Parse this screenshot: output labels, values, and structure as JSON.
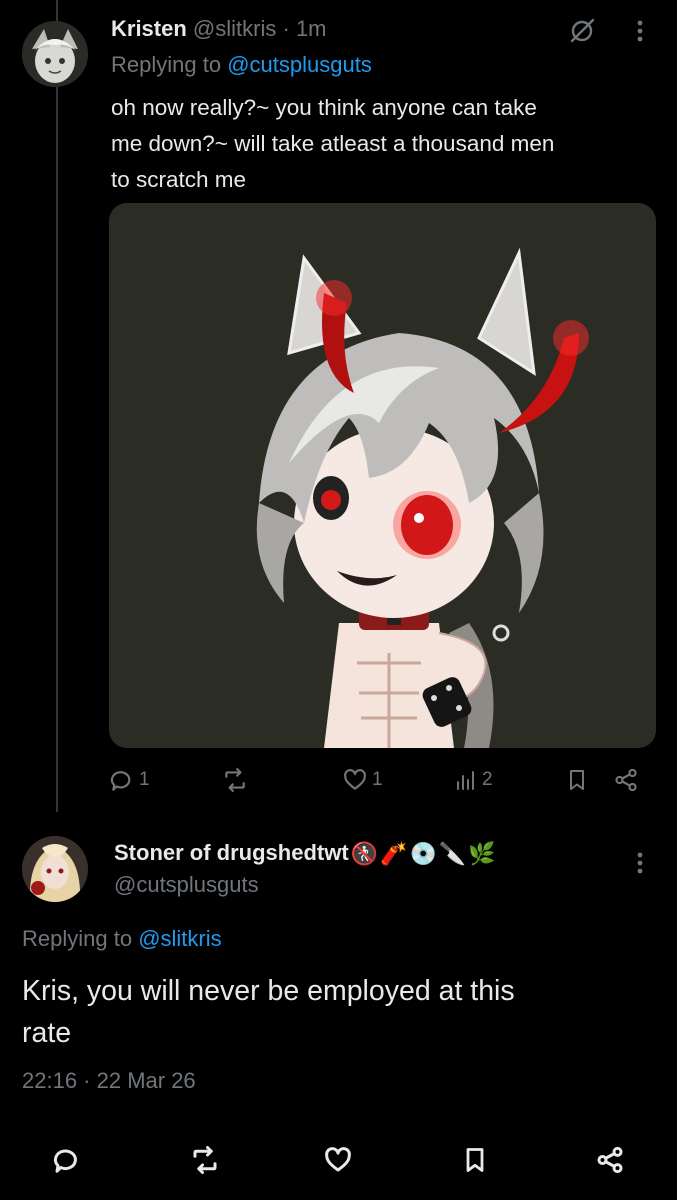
{
  "reply_tweet": {
    "author_name": "Kristen",
    "author_handle": "@slitkris",
    "separator": "·",
    "time": "1m",
    "replying_label": "Replying to",
    "replying_to": "@cutsplusguts",
    "text_lines": [
      "oh now really?~ you think anyone can take",
      "me down?~ will take atleast a thousand men",
      "to scratch me"
    ],
    "stats": {
      "replies": "1",
      "likes": "1",
      "views": "2"
    }
  },
  "main_tweet": {
    "author_name": "Stoner of drugshedtwt",
    "name_emojis": [
      "🚷",
      "🧨",
      "💿",
      "🔪",
      "🌿"
    ],
    "author_handle": "@cutsplusguts",
    "replying_label": "Replying to",
    "replying_to": "@slitkris",
    "text_lines": [
      "Kris, you will never be employed at this",
      "rate"
    ],
    "timestamp": "22:16 · 22 Mar 26"
  },
  "colors": {
    "background": "#000000",
    "text": "#e7e9ea",
    "muted": "#71767b",
    "link": "#1d9bf0",
    "thread_line": "#333639"
  },
  "icons": {
    "more": "more-vertical-icon",
    "grok": "grok-icon",
    "reply": "reply-icon",
    "repost": "repost-icon",
    "like": "like-icon",
    "views": "views-icon",
    "bookmark": "bookmark-icon",
    "share": "share-icon"
  }
}
